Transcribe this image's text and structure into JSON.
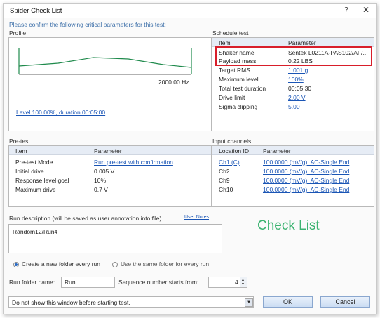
{
  "window": {
    "title": "Spider Check List",
    "help": "?",
    "close": "✕"
  },
  "instruction": "Please confirm the following critical parameters for this test:",
  "profile": {
    "label": "Profile",
    "freq_label": "2000.00 Hz",
    "level_link": "Level 100.00%, duration 00:05:00"
  },
  "schedule": {
    "label": "Schedule test",
    "headers": [
      "Item",
      "Parameter"
    ],
    "rows": [
      {
        "item": "Shaker name",
        "value": "Sentek L0211A-PAS102/AF/..."
      },
      {
        "item": "Payload mass",
        "value": "0.22 LBS"
      },
      {
        "item": "Target RMS",
        "value": "1.001 g"
      },
      {
        "item": "Maximum level",
        "value": "100%"
      },
      {
        "item": "Total test duration",
        "value": "00:05:30"
      },
      {
        "item": "Drive limit",
        "value": "2.00 V"
      },
      {
        "item": "Sigma clipping",
        "value": "5.00"
      }
    ]
  },
  "pretest": {
    "label": "Pre-test",
    "headers": [
      "Item",
      "Parameter"
    ],
    "rows": [
      {
        "item": "Pre-test Mode",
        "value": "Run pre-test with confirmation"
      },
      {
        "item": "Initial drive",
        "value": "0.005 V"
      },
      {
        "item": "Response level goal",
        "value": "10%"
      },
      {
        "item": "Maximum drive",
        "value": "0.7 V"
      }
    ]
  },
  "input_channels": {
    "label": "Input channels",
    "headers": [
      "Location ID",
      "Parameter"
    ],
    "rows": [
      {
        "item": "Ch1 (C)",
        "value": "100.0000 (mV/g), AC-Single End"
      },
      {
        "item": "Ch2",
        "value": "100.0000 (mV/g), AC-Single End"
      },
      {
        "item": "Ch9",
        "value": "100.0000 (mV/g), AC-Single End"
      },
      {
        "item": "Ch10",
        "value": "100.0000 (mV/g), AC-Single End"
      }
    ]
  },
  "run_description": {
    "label": "Run description (will be saved as user annotation into file)",
    "user_notes": "User Notes",
    "text": "Random12/Run4"
  },
  "overlay_text": "Check List",
  "folder_options": {
    "new_folder": "Create a new folder every run",
    "same_folder": "Use the same folder  for every run",
    "selected": "new_folder"
  },
  "run_folder": {
    "label": "Run folder name:",
    "value": "Run",
    "seq_label": "Sequence number starts from:",
    "seq_value": "4"
  },
  "show_window": {
    "value": "Do not show this window before starting test."
  },
  "buttons": {
    "ok": "OK",
    "cancel": "Cancel"
  },
  "colors": {
    "highlight": "#d81e2a",
    "link": "#1a55b5",
    "overlay": "#3cb371"
  }
}
